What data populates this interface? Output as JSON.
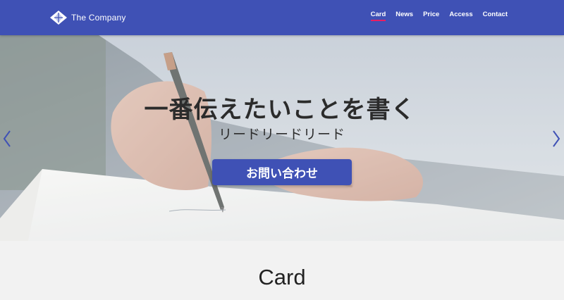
{
  "header": {
    "brand_name": "The Company",
    "logo_icon": "diamond-logo-icon",
    "nav": [
      {
        "label": "Card",
        "active": true
      },
      {
        "label": "News",
        "active": false
      },
      {
        "label": "Price",
        "active": false
      },
      {
        "label": "Access",
        "active": false
      },
      {
        "label": "Contact",
        "active": false
      }
    ]
  },
  "hero": {
    "title": "一番伝えたいことを書く",
    "lead": "リードリードリード",
    "cta_label": "お問い合わせ",
    "prev_icon": "chevron-left-icon",
    "next_icon": "chevron-right-icon"
  },
  "section": {
    "title": "Card"
  },
  "colors": {
    "primary": "#3f51b5",
    "active_underline": "#e91e63",
    "arrow": "#3f51b5"
  }
}
